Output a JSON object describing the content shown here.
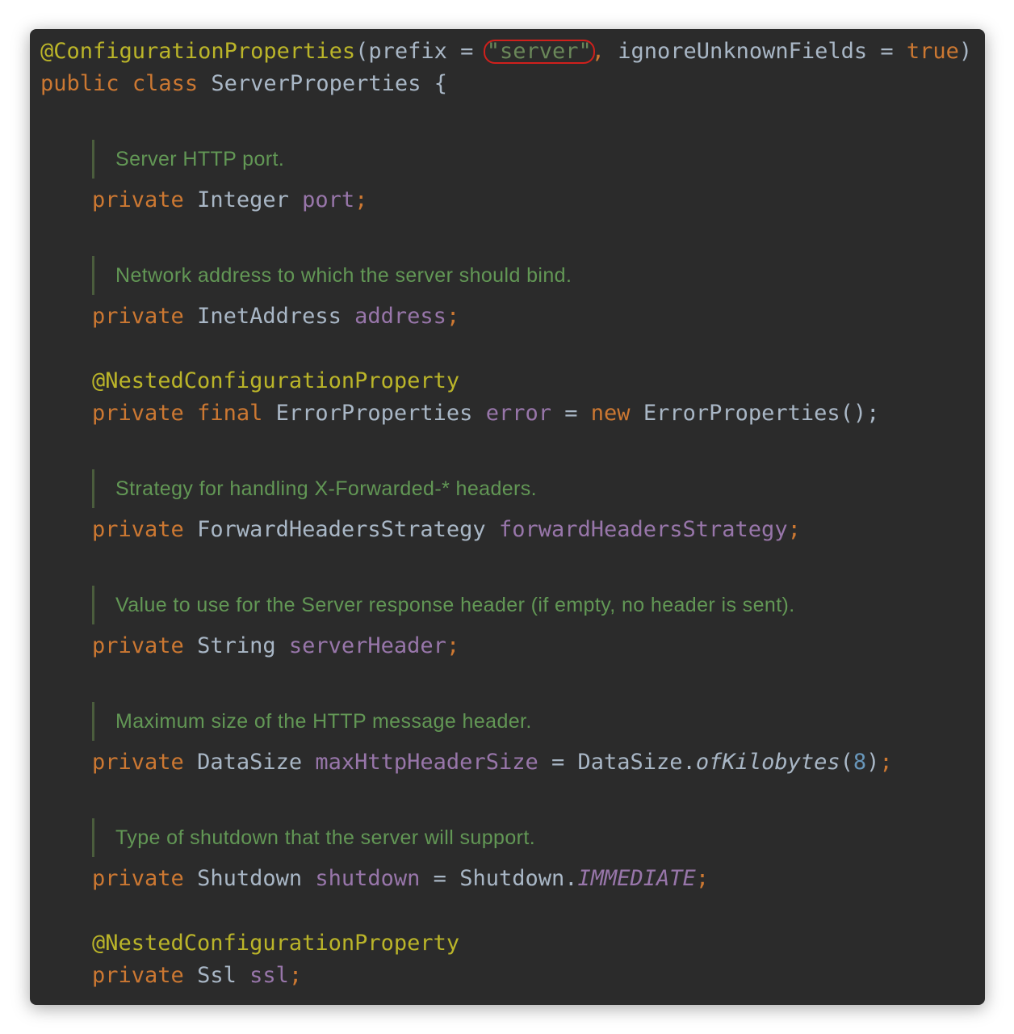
{
  "code": {
    "line1": {
      "annotation": "@ConfigurationProperties",
      "open": "(prefix = ",
      "prefix_value": "\"server\"",
      "comma": ", ignoreUnknownFields = ",
      "true_kw": "true",
      "close": ")"
    },
    "line2": {
      "kw_public": "public",
      "kw_class": "class",
      "class_name": "ServerProperties {"
    },
    "kw_private": "private",
    "kw_final": "final",
    "kw_new": "new",
    "nested_annotation": "@NestedConfigurationProperty",
    "fields": [
      {
        "doc": "Server HTTP port.",
        "type": "Integer",
        "name": "port"
      },
      {
        "doc": "Network address to which the server should bind.",
        "type": "InetAddress",
        "name": "address"
      },
      {
        "type": "ErrorProperties",
        "name": "error",
        "init_call": "ErrorProperties();"
      },
      {
        "doc": "Strategy for handling X-Forwarded-* headers.",
        "type": "ForwardHeadersStrategy",
        "name": "forwardHeadersStrategy"
      },
      {
        "doc": "Value to use for the Server response header (if empty, no header is sent).",
        "type": "String",
        "name": "serverHeader"
      },
      {
        "doc": "Maximum size of the HTTP message header.",
        "type": "DataSize",
        "name": "maxHttpHeaderSize",
        "init_class": "DataSize.",
        "init_method": "ofKilobytes",
        "init_arg": "8"
      },
      {
        "doc": "Type of shutdown that the server will support.",
        "type": "Shutdown",
        "name": "shutdown",
        "init_class": "Shutdown.",
        "init_const": "IMMEDIATE"
      },
      {
        "type": "Ssl",
        "name": "ssl"
      }
    ]
  },
  "colors": {
    "background": "#2b2b2b",
    "keyword": "#cc7832",
    "annotation": "#bbb529",
    "field": "#9876aa",
    "string": "#6a8759",
    "number": "#6897bb",
    "doc_comment": "#629755",
    "text": "#a9b7c6",
    "highlight_circle": "#d0201c"
  }
}
